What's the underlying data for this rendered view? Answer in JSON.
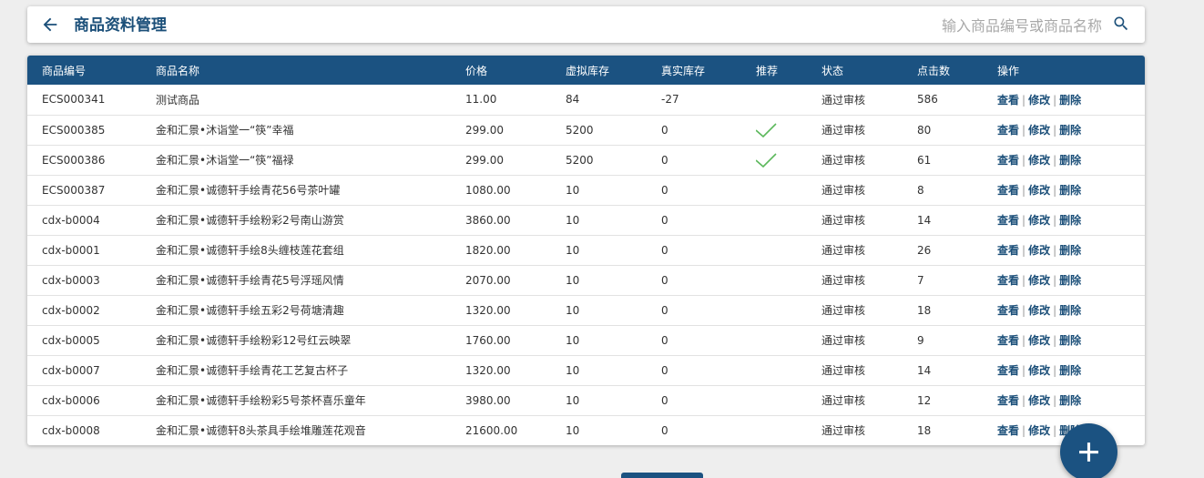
{
  "header": {
    "title": "商品资料管理",
    "search_placeholder": "输入商品编号或商品名称",
    "back_icon": "arrow-left-icon",
    "search_icon": "magnifier-icon"
  },
  "table": {
    "columns": [
      "商品编号",
      "商品名称",
      "价格",
      "虚拟库存",
      "真实库存",
      "推荐",
      "状态",
      "点击数",
      "操作"
    ],
    "rows": [
      {
        "id": "ECS000341",
        "name": "测试商品",
        "price": "11.00",
        "virtual_stock": "84",
        "real_stock": "-27",
        "recommended": false,
        "status": "通过审核",
        "clicks": "586"
      },
      {
        "id": "ECS000385",
        "name": "金和汇景•沐诣堂一“筷”幸福",
        "price": "299.00",
        "virtual_stock": "5200",
        "real_stock": "0",
        "recommended": true,
        "status": "通过审核",
        "clicks": "80"
      },
      {
        "id": "ECS000386",
        "name": "金和汇景•沐诣堂一“筷”福禄",
        "price": "299.00",
        "virtual_stock": "5200",
        "real_stock": "0",
        "recommended": true,
        "status": "通过审核",
        "clicks": "61"
      },
      {
        "id": "ECS000387",
        "name": "金和汇景•诚德轩手绘青花56号茶叶罐",
        "price": "1080.00",
        "virtual_stock": "10",
        "real_stock": "0",
        "recommended": false,
        "status": "通过审核",
        "clicks": "8"
      },
      {
        "id": "cdx-b0004",
        "name": "金和汇景•诚德轩手绘粉彩2号南山游赏",
        "price": "3860.00",
        "virtual_stock": "10",
        "real_stock": "0",
        "recommended": false,
        "status": "通过审核",
        "clicks": "14"
      },
      {
        "id": "cdx-b0001",
        "name": "金和汇景•诚德轩手绘8头缠枝莲花套组",
        "price": "1820.00",
        "virtual_stock": "10",
        "real_stock": "0",
        "recommended": false,
        "status": "通过审核",
        "clicks": "26"
      },
      {
        "id": "cdx-b0003",
        "name": "金和汇景•诚德轩手绘青花5号浮瑶风情",
        "price": "2070.00",
        "virtual_stock": "10",
        "real_stock": "0",
        "recommended": false,
        "status": "通过审核",
        "clicks": "7"
      },
      {
        "id": "cdx-b0002",
        "name": "金和汇景•诚德轩手绘五彩2号荷塘清趣",
        "price": "1320.00",
        "virtual_stock": "10",
        "real_stock": "0",
        "recommended": false,
        "status": "通过审核",
        "clicks": "18"
      },
      {
        "id": "cdx-b0005",
        "name": "金和汇景•诚德轩手绘粉彩12号红云映翠",
        "price": "1760.00",
        "virtual_stock": "10",
        "real_stock": "0",
        "recommended": false,
        "status": "通过审核",
        "clicks": "9"
      },
      {
        "id": "cdx-b0007",
        "name": "金和汇景•诚德轩手绘青花工艺复古杯子",
        "price": "1320.00",
        "virtual_stock": "10",
        "real_stock": "0",
        "recommended": false,
        "status": "通过审核",
        "clicks": "14"
      },
      {
        "id": "cdx-b0006",
        "name": "金和汇景•诚德轩手绘粉彩5号茶杯喜乐童年",
        "price": "3980.00",
        "virtual_stock": "10",
        "real_stock": "0",
        "recommended": false,
        "status": "通过审核",
        "clicks": "12"
      },
      {
        "id": "cdx-b0008",
        "name": "金和汇景•诚德轩8头茶具手绘堆雕莲花观音",
        "price": "21600.00",
        "virtual_stock": "10",
        "real_stock": "0",
        "recommended": false,
        "status": "通过审核",
        "clicks": "18"
      }
    ],
    "actions": {
      "view": "查看",
      "edit": "修改",
      "delete": "删除",
      "separator": "|"
    },
    "recommend_icon": "checkmark-icon"
  },
  "fab": {
    "icon": "plus-icon"
  },
  "colors": {
    "primary": "#1b5281",
    "title": "#1b4f79",
    "check": "#5cb85c",
    "background": "#eeeeee"
  }
}
